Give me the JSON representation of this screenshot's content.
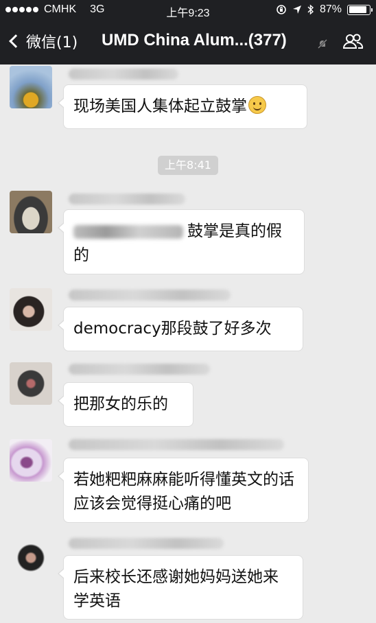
{
  "status_bar": {
    "carrier": "CMHK",
    "network": "3G",
    "time": "上午9:23",
    "battery_text": "87%",
    "battery_level": 0.87
  },
  "nav": {
    "back_label": "微信(1)",
    "title": "UMD China Alum...(377)",
    "icons": [
      "mute-icon",
      "members-icon"
    ]
  },
  "timestamp": "上午8:41",
  "messages": [
    {
      "text": "现场美国人集体起立鼓掌",
      "emoji": "smiley"
    },
    {
      "text": "鼓掌是真的假的"
    },
    {
      "text": "democracy那段鼓了好多次"
    },
    {
      "text": "把那女的乐的"
    },
    {
      "text": "若她粑粑麻麻能听得懂英文的话应该会觉得挺心痛的吧"
    },
    {
      "text": "后来校长还感谢她妈妈送她来学英语"
    }
  ],
  "colors": {
    "bar_background": "#1f2023",
    "chat_background": "#ebebeb",
    "bubble": "#ffffff",
    "timestamp_pill": "#d0d0d0"
  }
}
